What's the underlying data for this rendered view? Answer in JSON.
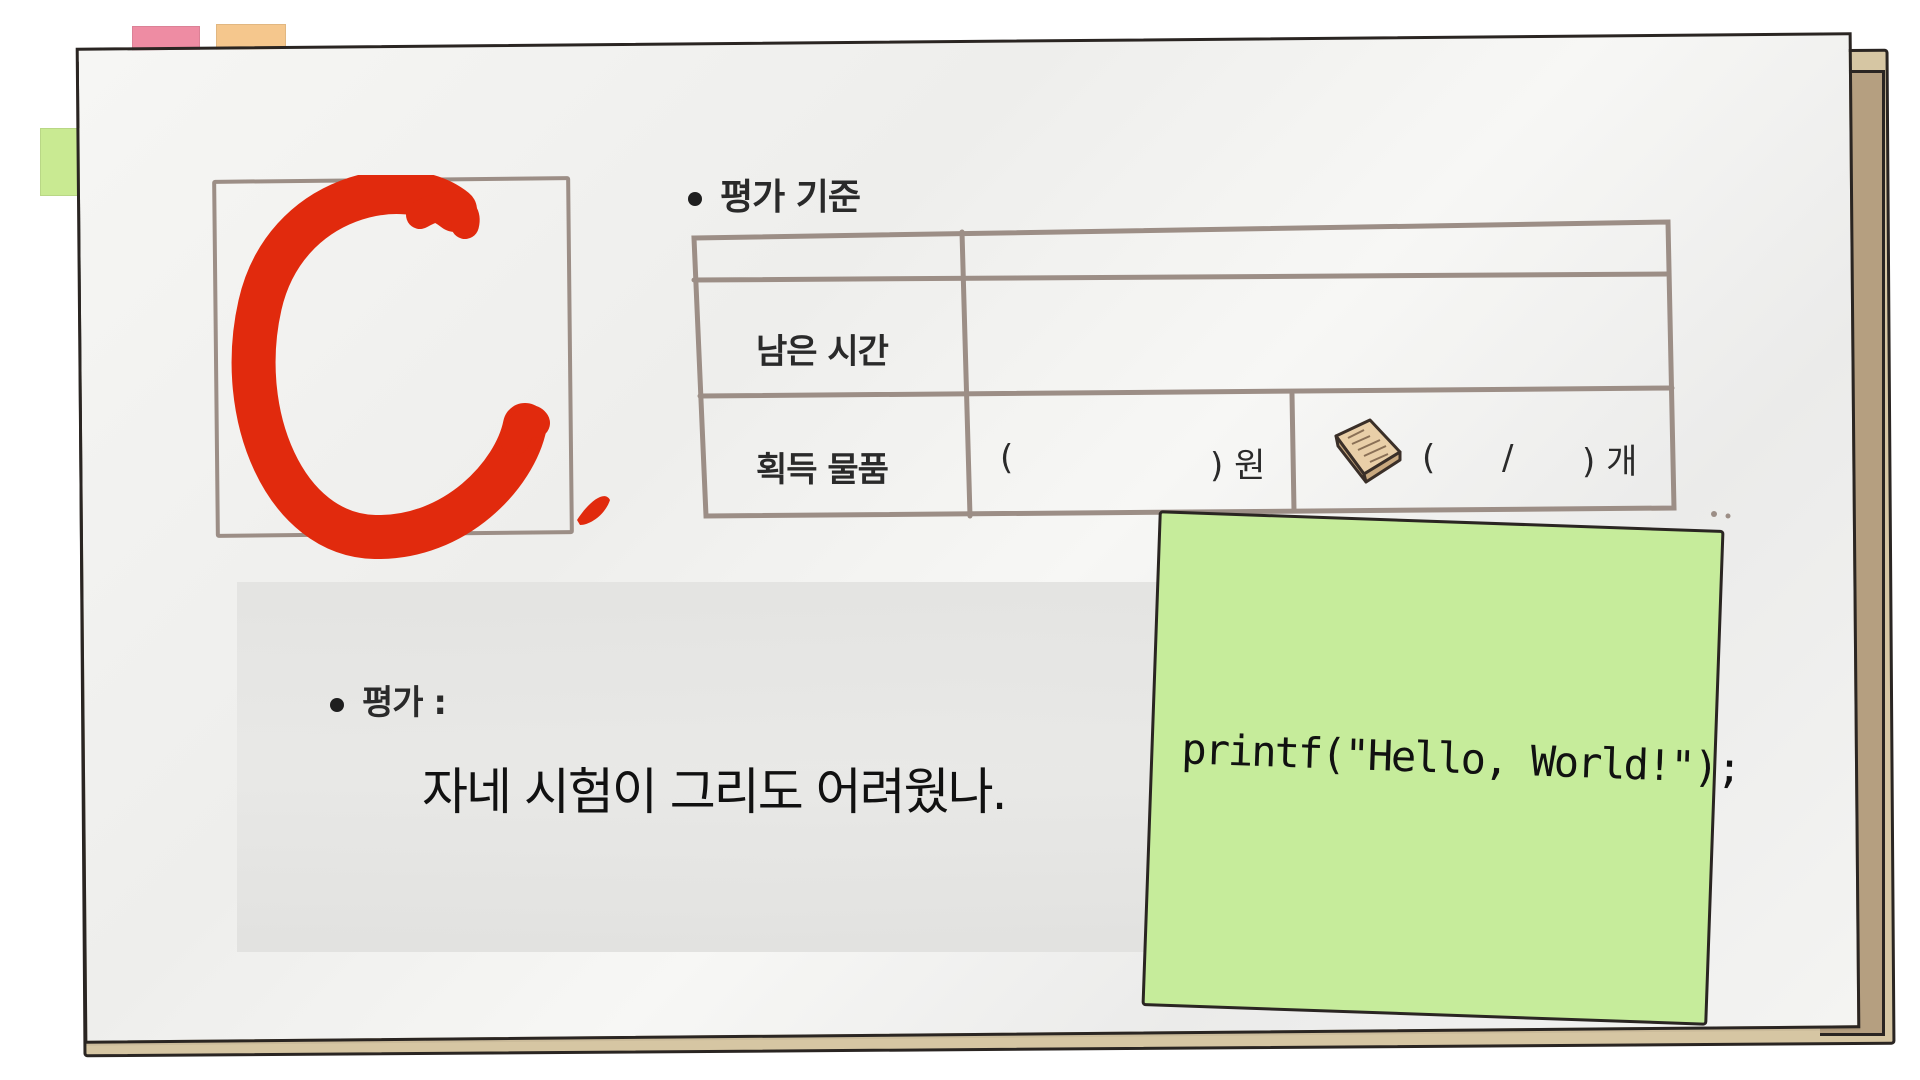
{
  "grade": {
    "letter": "C."
  },
  "criteria": {
    "title": "평가 기준",
    "rows": [
      {
        "label": "",
        "value": ""
      },
      {
        "label": "남은 시간",
        "value": ""
      },
      {
        "label": "획득 물품"
      }
    ],
    "money": {
      "open": "(",
      "close": ") 원"
    },
    "items": {
      "open": "(",
      "separator": "/",
      "close": ") 개",
      "icon": "book-icon"
    }
  },
  "evaluation": {
    "label": "평가 :",
    "comment": "자네 시험이 그리도 어려웠나."
  },
  "sticky_note": {
    "text": "printf(\"Hello, World!\");"
  },
  "colors": {
    "grade_red": "#e12a0d",
    "sticky_green": "#c6ec9b",
    "tab_pink": "#ee8ca3",
    "tab_orange": "#f5c78d",
    "tab_green": "#c9ea92"
  }
}
